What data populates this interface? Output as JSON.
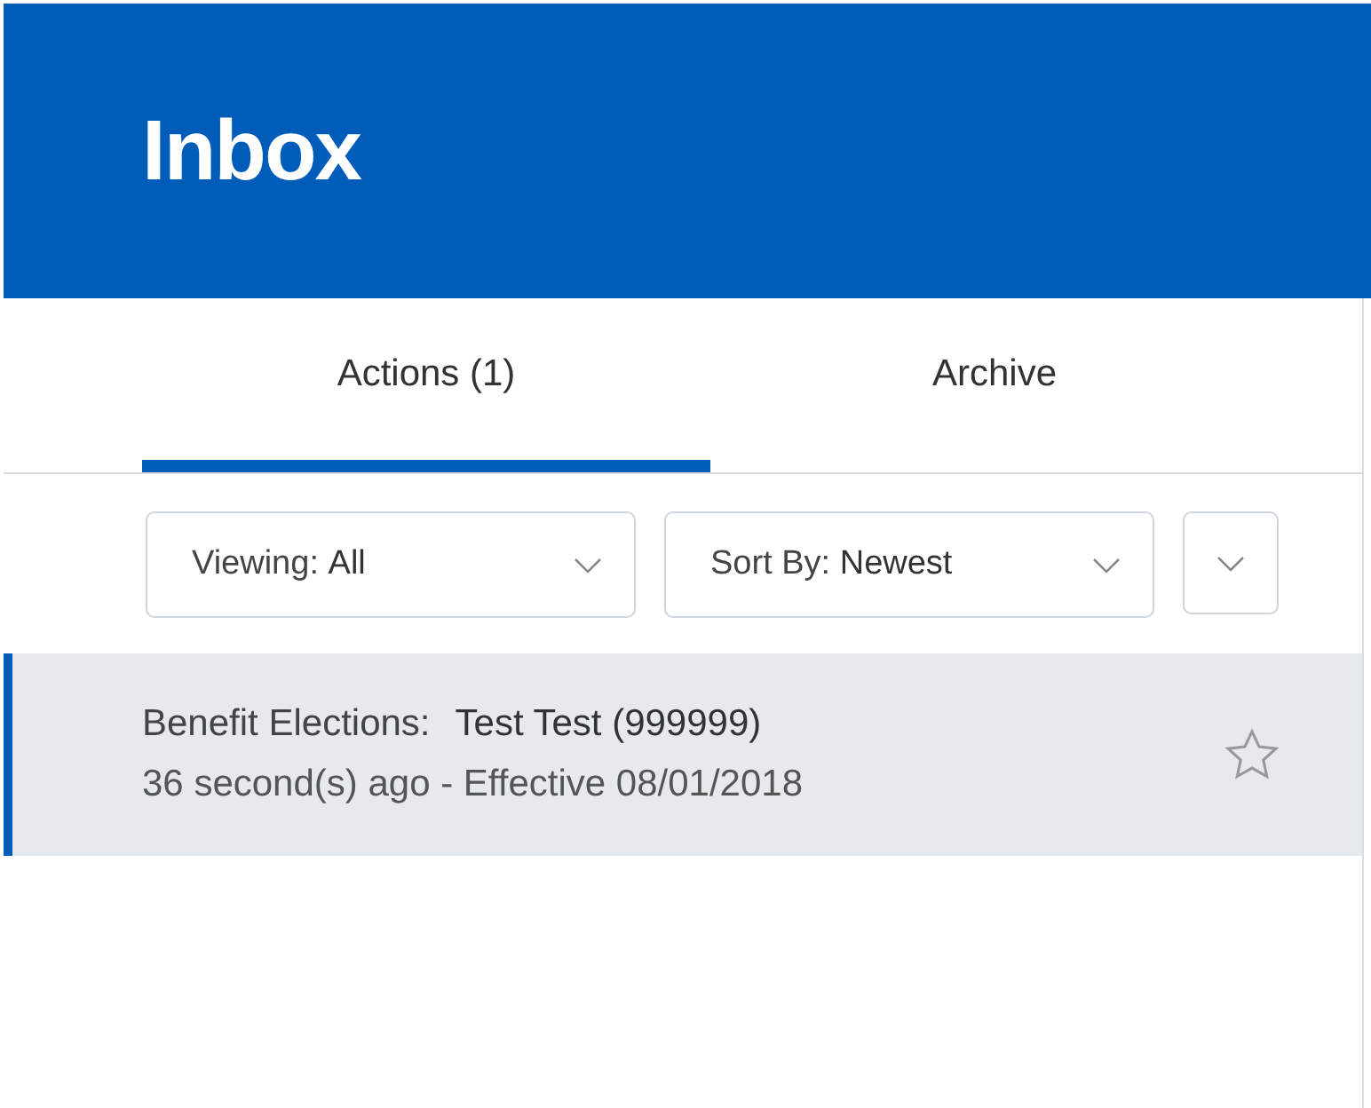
{
  "header": {
    "title": "Inbox"
  },
  "tabs": [
    {
      "label": "Actions (1)",
      "selected": true
    },
    {
      "label": "Archive",
      "selected": false
    }
  ],
  "filters": [
    {
      "label": "Viewing:",
      "value": "All"
    },
    {
      "label": "Sort By:",
      "value": "Newest"
    }
  ],
  "items": [
    {
      "title": "Benefit Elections:",
      "subject": "Test Test (999999)",
      "meta": "36 second(s) ago - Effective 08/01/2018",
      "selected": true
    }
  ]
}
